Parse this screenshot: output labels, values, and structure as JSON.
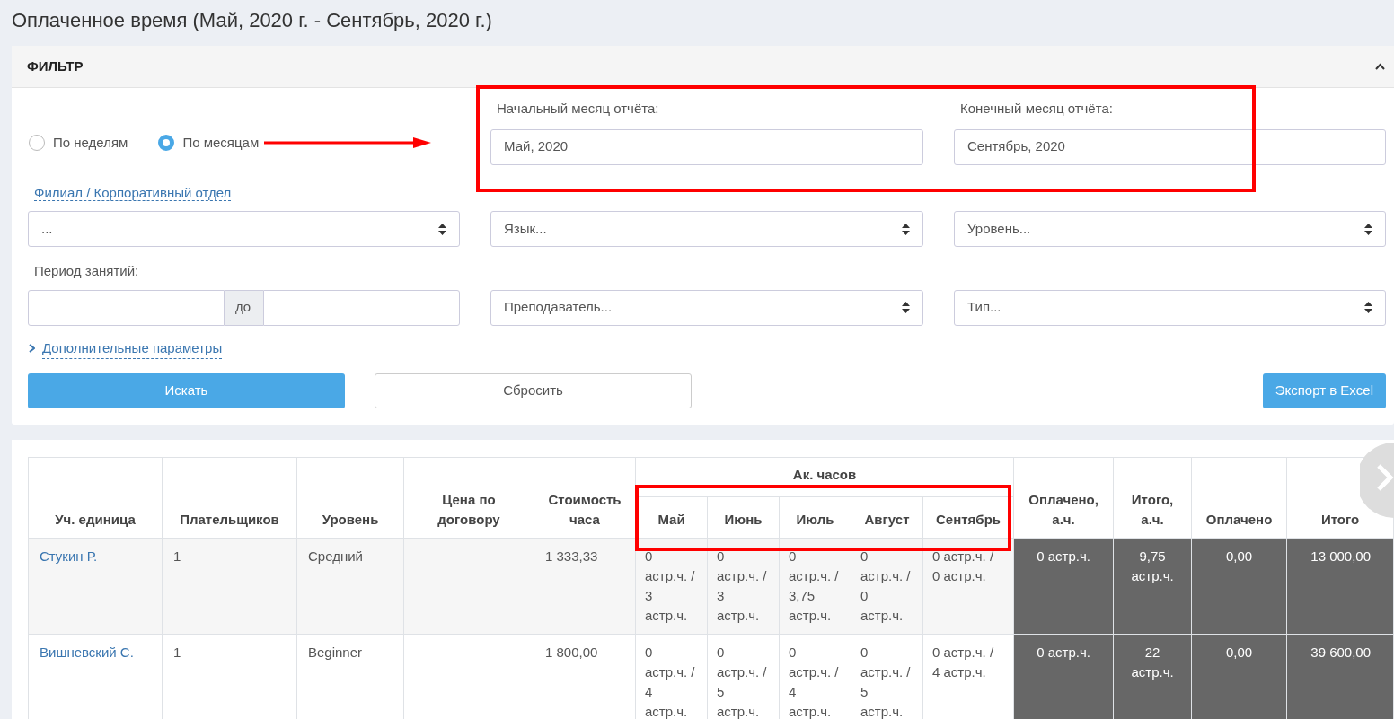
{
  "page_title": "Оплаченное время (Май, 2020 г. - Сентябрь, 2020 г.)",
  "filter": {
    "title": "ФИЛЬТР",
    "expanded": true,
    "grouping": [
      {
        "label": "По неделям",
        "selected": false
      },
      {
        "label": "По месяцам",
        "selected": true
      }
    ],
    "start_month": {
      "label": "Начальный месяц отчёта:",
      "value": "Май, 2020"
    },
    "end_month": {
      "label": "Конечный месяц отчёта:",
      "value": "Сентябрь, 2020"
    },
    "branch_link": "Филиал / Корпоративный отдел",
    "selects": [
      {
        "value": "..."
      },
      {
        "value": "Язык..."
      },
      {
        "value": "Уровень..."
      },
      {
        "value": "Преподаватель..."
      },
      {
        "value": "Тип..."
      }
    ],
    "period": {
      "label": "Период занятий:",
      "separator": "до"
    },
    "more_params": {
      "label": "Дополнительные параметры",
      "expanded": false
    },
    "buttons": {
      "search": "Искать",
      "reset": "Сбросить",
      "export": "Экспорт в Excel"
    }
  },
  "table": {
    "group_header": "Ак. часов",
    "lead_columns": [
      "Уч. единица",
      "Плательщиков",
      "Уровень",
      "Цена по договору",
      "Стоимость часа"
    ],
    "month_columns": [
      "Май",
      "Июнь",
      "Июль",
      "Август",
      "Сентябрь"
    ],
    "tail_columns": [
      "Оплачено, а.ч.",
      "Итого, а.ч.",
      "Оплачено",
      "Итого"
    ],
    "rows": [
      {
        "unit": "Стукин Р.",
        "payers": "1",
        "level": "Средний",
        "hour_cost": "1 333,33",
        "months": [
          "0 астр.ч. / 3 астр.ч.",
          "0 астр.ч. / 3 астр.ч.",
          "0 астр.ч. / 3,75 астр.ч.",
          "0 астр.ч. / 0 астр.ч.",
          "0 астр.ч. / 0 астр.ч."
        ],
        "paid_hours": "0 астр.ч.",
        "total_hours": "9,75 астр.ч.",
        "paid": "0,00",
        "total": "13 000,00"
      },
      {
        "unit": "Вишневский С.",
        "payers": "1",
        "level": "Beginner",
        "hour_cost": "1 800,00",
        "months": [
          "0 астр.ч. / 4 астр.ч.",
          "0 астр.ч. / 5 астр.ч.",
          "0 астр.ч. / 4 астр.ч.",
          "0 астр.ч. / 5 астр.ч.",
          "0 астр.ч. / 4 астр.ч."
        ],
        "paid_hours": "0 астр.ч.",
        "total_hours": "22 астр.ч.",
        "paid": "0,00",
        "total": "39 600,00"
      }
    ]
  }
}
